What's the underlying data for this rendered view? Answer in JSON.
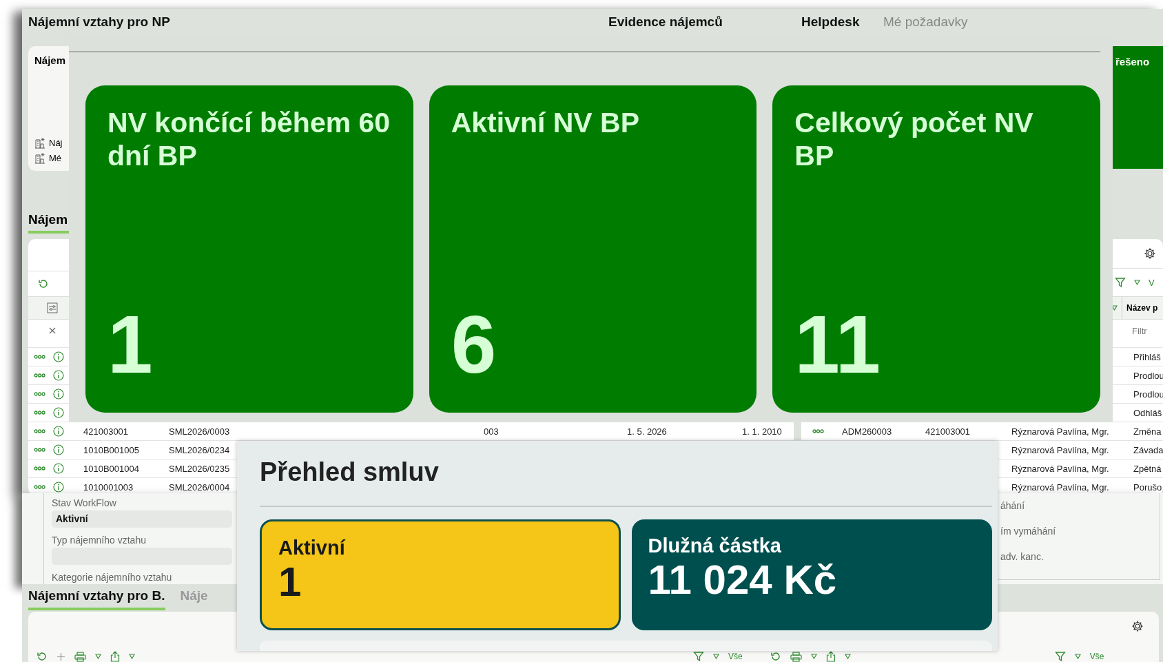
{
  "main_window": {
    "title": "Nájemní vztahy pro NP",
    "headings": [
      "Evidence nájemců",
      "Helpdesk"
    ],
    "helpdesk_tab": "Mé požadavky",
    "links_card": {
      "title": "Nájem",
      "items": [
        "Náj",
        "Mé"
      ]
    },
    "status_tile": {
      "label": "řešeno"
    },
    "section_title": "Nájem",
    "left_table": {
      "rows": [
        {
          "kind": "covered"
        },
        {
          "kind": "covered"
        },
        {
          "kind": "covered"
        },
        {
          "kind": "covered"
        },
        {
          "kind": "full",
          "cells": [
            "421003001",
            "SML2026/0003",
            "003",
            "1. 5. 2026",
            "1. 1. 2010"
          ]
        },
        {
          "kind": "partial",
          "cells": [
            "1010B001005",
            "SML2026/0234"
          ]
        },
        {
          "kind": "partial",
          "cells": [
            "1010B001004",
            "SML2026/0235"
          ]
        },
        {
          "kind": "partial",
          "cells": [
            "1010001003",
            "SML2026/0004"
          ]
        }
      ]
    },
    "right_table": {
      "column": "Název p",
      "filter_placeholder": "Filtr",
      "filter_label": "V",
      "rows": [
        {
          "kind": "covered",
          "title": "Přihláš"
        },
        {
          "kind": "covered",
          "title": "Prodlou"
        },
        {
          "kind": "covered",
          "title": "Prodlou"
        },
        {
          "kind": "covered",
          "title": "Odhláš"
        },
        {
          "kind": "full",
          "code": "ADM260003",
          "unit": "421003001",
          "name": "Rýznarová Pavlína, Mgr.",
          "title": "Změna"
        },
        {
          "kind": "partial",
          "name": "Rýznarová Pavlína, Mgr.",
          "title": "Závada"
        },
        {
          "kind": "partial",
          "name": "Rýznarová Pavlína, Mgr.",
          "title": "Zpětná"
        },
        {
          "kind": "partial",
          "name": "Rýznarová Pavlína, Mgr.",
          "title": "Porušo"
        }
      ]
    }
  },
  "kpi_overlay": {
    "cards": [
      {
        "title": "NV končící během 60 dní BP",
        "value": "1"
      },
      {
        "title": "Aktivní NV BP",
        "value": "6"
      },
      {
        "title": "Celkový počet NV BP",
        "value": "11"
      }
    ]
  },
  "form_window": {
    "fields": [
      {
        "kind": "field",
        "label": "Stav WorkFlow",
        "value": "Aktivní"
      },
      {
        "kind": "field",
        "label": "Typ nájemního vztahu"
      },
      {
        "kind": "label",
        "label": "Kategorie nájemního vztahu"
      }
    ],
    "options": [
      "áhání",
      "ím vymáhání",
      "adv. kanc."
    ]
  },
  "bottom_window": {
    "tabs": [
      {
        "label": "Nájemní vztahy pro B.",
        "selected": true
      },
      {
        "label": "Náje",
        "selected": false
      }
    ],
    "filter_labels": [
      "Vše",
      "Vše"
    ]
  },
  "overview": {
    "title": "Přehled smluv",
    "cards": [
      {
        "kind": "status",
        "label": "Aktivní",
        "value": "1"
      },
      {
        "kind": "debt",
        "label": "Dlužná částka",
        "value": "11 024 Kč"
      }
    ]
  }
}
